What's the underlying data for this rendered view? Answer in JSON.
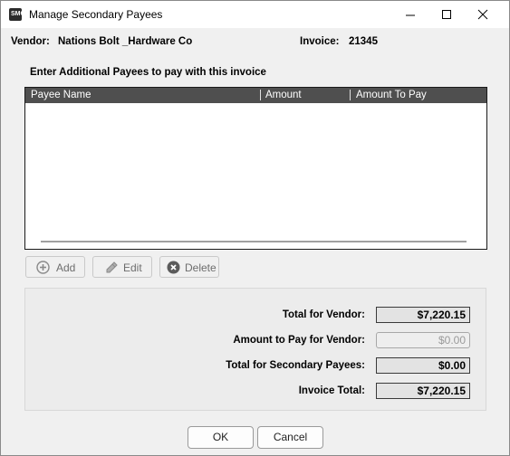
{
  "window": {
    "title": "Manage Secondary Payees",
    "app_icon_text": "SMC",
    "controls": [
      "minimize-icon",
      "maximize-icon",
      "close-icon"
    ]
  },
  "vendor": {
    "label": "Vendor:",
    "value": "Nations Bolt _Hardware Co"
  },
  "invoice": {
    "label": "Invoice:",
    "value": "21345"
  },
  "instructions": "Enter Additional Payees to pay with this invoice",
  "grid": {
    "columns": [
      "Payee Name",
      "Amount",
      "Amount To Pay"
    ],
    "rows": []
  },
  "actions": {
    "add": "Add",
    "edit": "Edit",
    "delete": "Delete"
  },
  "totals": {
    "vendor_total_label": "Total for Vendor:",
    "vendor_total_value": "$7,220.15",
    "pay_vendor_label": "Amount to Pay for Vendor:",
    "pay_vendor_value": "$0.00",
    "secondary_label": "Total for Secondary Payees:",
    "secondary_value": "$0.00",
    "invoice_total_label": "Invoice Total:",
    "invoice_total_value": "$7,220.15"
  },
  "footer": {
    "ok": "OK",
    "cancel": "Cancel"
  }
}
